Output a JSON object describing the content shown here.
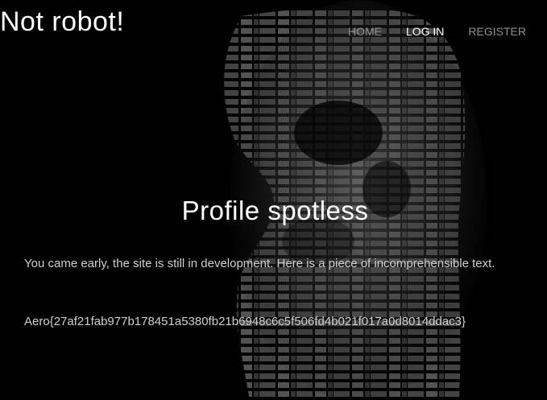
{
  "site": {
    "title": "Not robot!"
  },
  "nav": {
    "items": [
      {
        "label": "HOME",
        "active": false
      },
      {
        "label": "LOG IN",
        "active": true
      },
      {
        "label": "REGISTER",
        "active": false
      }
    ]
  },
  "main": {
    "heading": "Profile spotless",
    "paragraph": "You came early, the site is still in development. Here is a piece of incomprehensible text.",
    "flag": "Aero{27af21fab977b178451a5380fb21b6948c6c5f506fd4b021f017a0d8014ddac3}"
  },
  "colors": {
    "background": "#000000",
    "text": "#ffffff",
    "nav_inactive": "#8f8f8f",
    "nav_active": "#ffffff"
  }
}
